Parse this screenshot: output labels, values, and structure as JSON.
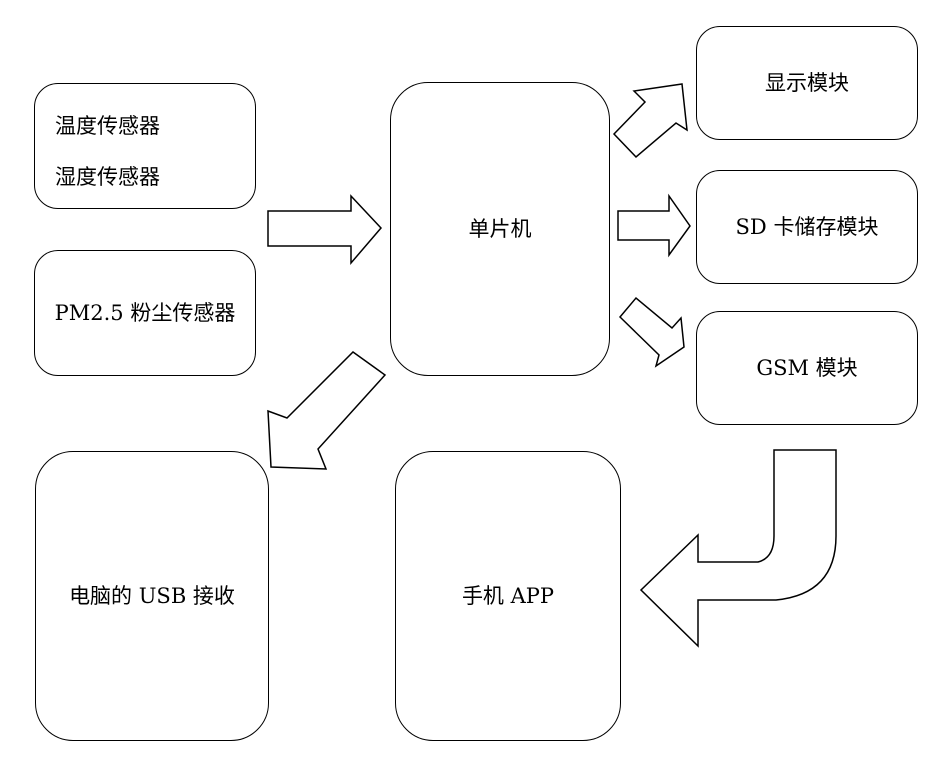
{
  "sensors": {
    "temperature": "温度传感器",
    "humidity": "湿度传感器",
    "pm25": "PM2.5 粉尘传感器"
  },
  "mcu": "单片机",
  "outputs": {
    "display": "显示模块",
    "sd_storage": "SD 卡储存模块",
    "gsm": "GSM 模块"
  },
  "receivers": {
    "pc_usb": "电脑的 USB 接收",
    "phone_app": "手机 APP"
  }
}
